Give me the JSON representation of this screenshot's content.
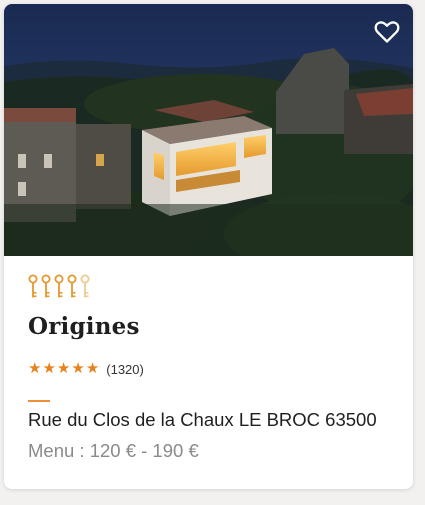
{
  "restaurant": {
    "name": "Origines",
    "rating": {
      "stars": 5,
      "max_stars": 5,
      "count_label": "(1320)"
    },
    "keys": {
      "filled": 4,
      "total": 5
    },
    "address": "Rue du Clos de la Chaux LE BROC 63500",
    "menu_price": "Menu : 120 € - 190 €"
  },
  "icons": {
    "favorite": "heart-outline-icon",
    "key": "key-icon",
    "star": "star-icon"
  },
  "colors": {
    "accent_orange": "#e8821e",
    "key_gold": "#e29a2f",
    "key_inactive": "#f0c98e",
    "title": "#1f1f1f",
    "muted": "#8a8a8a"
  }
}
